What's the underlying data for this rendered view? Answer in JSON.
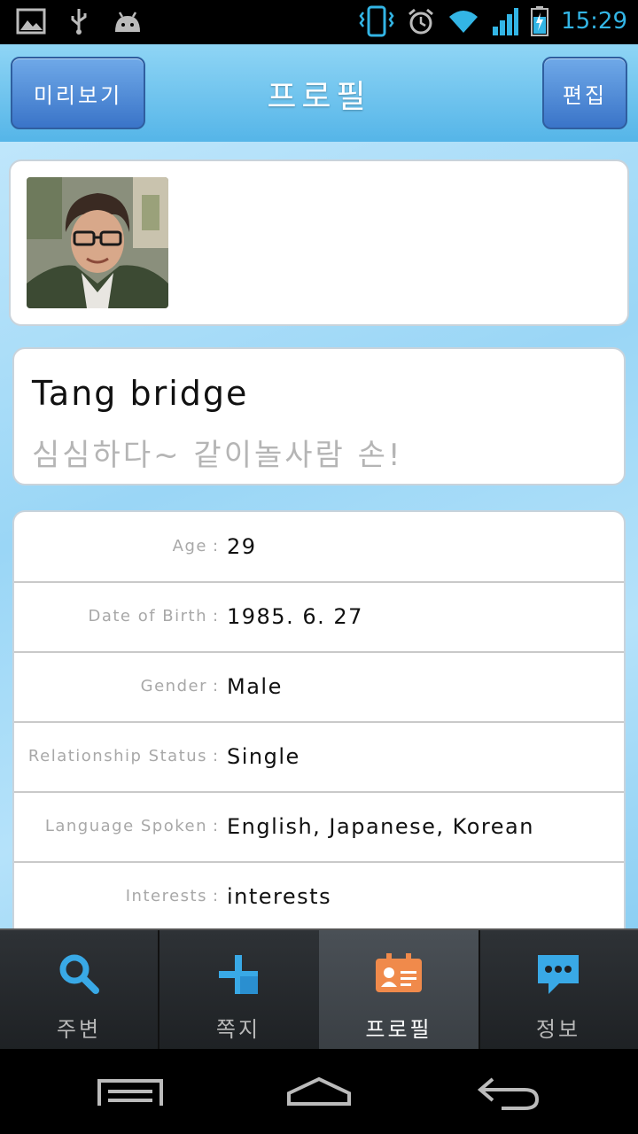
{
  "status_bar": {
    "time": "15:29",
    "left_icons": [
      "image-notification-icon",
      "usb-icon",
      "android-icon"
    ],
    "right_icons": [
      "vibrate-icon",
      "alarm-icon",
      "wifi-icon",
      "signal-icon",
      "battery-charging-icon"
    ]
  },
  "header": {
    "title": "프로필",
    "preview_label": "미리보기",
    "edit_label": "편집"
  },
  "profile": {
    "name": "Tang bridge",
    "status_message": "심심하다~ 같이놀사람 손!"
  },
  "info": [
    {
      "label": "Age",
      "value": "29"
    },
    {
      "label": "Date of Birth",
      "value": "1985. 6. 27"
    },
    {
      "label": "Gender",
      "value": "Male"
    },
    {
      "label": "Relationship Status",
      "value": "Single"
    },
    {
      "label": "Language Spoken",
      "value": "English, Japanese, Korean"
    },
    {
      "label": "Interests",
      "value": "interests"
    }
  ],
  "tabs": [
    {
      "label": "주변",
      "icon": "search-icon",
      "active": false
    },
    {
      "label": "쪽지",
      "icon": "message-icon",
      "active": false
    },
    {
      "label": "프로필",
      "icon": "profile-card-icon",
      "active": true
    },
    {
      "label": "정보",
      "icon": "chat-bubble-icon",
      "active": false
    }
  ],
  "colors": {
    "accent": "#33b5e5",
    "header_button": "#3a74c8",
    "tab_icon": "#39a9e6",
    "active_tab_icon": "#f08a4b"
  }
}
